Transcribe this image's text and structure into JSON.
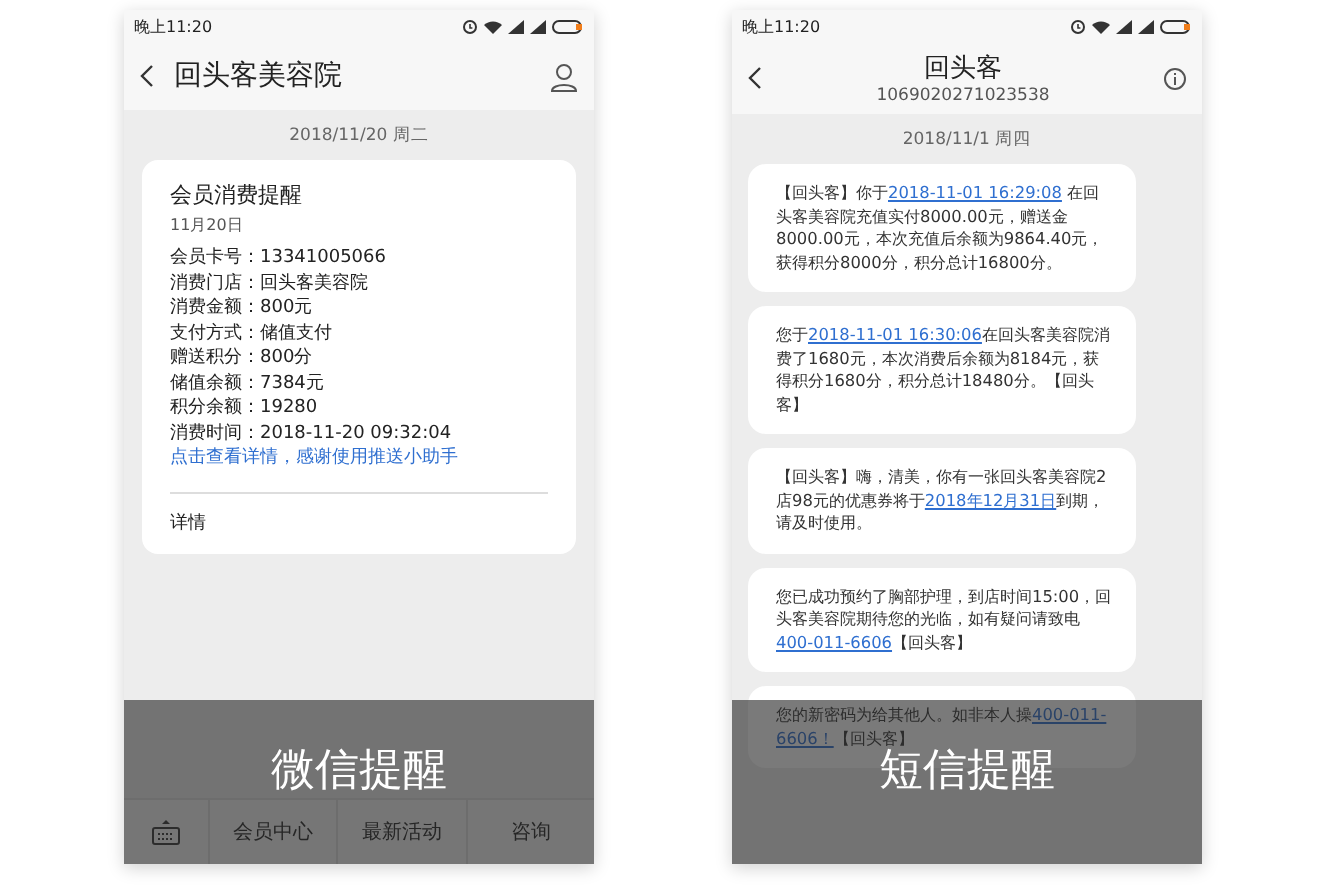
{
  "panels": [
    {
      "kind": "wechat",
      "status_bar": {
        "time": "晚上11:20"
      },
      "header": {
        "title": "回头客美容院"
      },
      "date": "2018/11/20 周二",
      "card": {
        "title": "会员消费提醒",
        "date": "11月20日",
        "fields": [
          "会员卡号：13341005066",
          "消费门店：回头客美容院",
          "消费金额：800元",
          "支付方式：储值支付",
          "赠送积分：800分",
          "储值余额：7384元",
          "积分余额：19280",
          "消费时间：2018-11-20  09:32:04"
        ],
        "link": "点击查看详情，感谢使用推送小助手",
        "footer": "详情"
      },
      "menu": [
        "会员中心",
        "最新活动",
        "咨询"
      ],
      "caption": "微信提醒"
    },
    {
      "kind": "sms",
      "status_bar": {
        "time": "晚上11:20"
      },
      "header": {
        "title": "回头客",
        "subtitle": "1069020271023538"
      },
      "date": "2018/11/1 周四",
      "messages": [
        {
          "segments": [
            {
              "kind": "plain",
              "text": "【回头客】你于"
            },
            {
              "kind": "link",
              "text": "2018-11-01 16:29:08"
            },
            {
              "kind": "plain",
              "text": " 在回头客美容院充值实付8000.00元，赠送金8000.00元，本次充值后余额为9864.40元，获得积分8000分，积分总计16800分。"
            }
          ]
        },
        {
          "segments": [
            {
              "kind": "plain",
              "text": "您于"
            },
            {
              "kind": "link",
              "text": "2018-11-01 16:30:06"
            },
            {
              "kind": "plain",
              "text": "在回头客美容院消费了1680元，本次消费后余额为8184元，获得积分1680分，积分总计18480分。【回头客】"
            }
          ]
        },
        {
          "segments": [
            {
              "kind": "plain",
              "text": "【回头客】嗨，清美，你有一张回头客美容院2店98元的优惠券将于"
            },
            {
              "kind": "link",
              "text": "2018年12月31日"
            },
            {
              "kind": "plain",
              "text": "到期，请及时使用。"
            }
          ]
        },
        {
          "segments": [
            {
              "kind": "plain",
              "text": "您已成功预约了胸部护理，到店时间15:00，回头客美容院期待您的光临，如有疑问请致电"
            },
            {
              "kind": "link",
              "text": "400-011-6606"
            },
            {
              "kind": "plain",
              "text": "【回头客】"
            }
          ]
        },
        {
          "segments": [
            {
              "kind": "plain",
              "text": "您的新密码为"
            },
            {
              "kind": "plain",
              "text": "给其他人。如非本人操"
            },
            {
              "kind": "link",
              "text": "400-011-6606！"
            },
            {
              "kind": "plain",
              "text": "【回头客】"
            }
          ]
        }
      ],
      "caption": "短信提醒"
    }
  ]
}
